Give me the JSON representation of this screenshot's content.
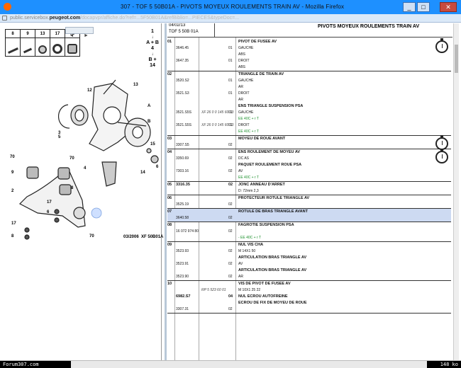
{
  "window": {
    "title": "307 - TOF 5 50B01A - PIVOTS MOYEUX ROULEMENTS TRAIN AV - Mozilla Firefox",
    "minimize_glyph": "_",
    "maximize_glyph": "□",
    "close_glyph": "✕"
  },
  "address_bar": {
    "url_prefix": "public.servicebox.",
    "url_bold": "peugeot.com",
    "url_rest": "/docapvpr/affiche.do?ref=...5F50B01A&refBiblio=...PIECES&typeDoc=..."
  },
  "diagram_panel": {
    "parts_header": [
      "8",
      "9",
      "13",
      "17",
      "70"
    ],
    "nav_arrows": [
      "◄",
      "►"
    ],
    "ref_box_1": {
      "num": "1",
      "arrow": "↓",
      "label": "A + B"
    },
    "ref_box_2": {
      "num": "4",
      "arrow": "↓",
      "label": "B + 14"
    },
    "callouts": [
      "13",
      "12",
      "3",
      "A",
      "5",
      "B",
      "15",
      "4",
      "14",
      "6",
      "70",
      "9",
      "70",
      "8",
      "2",
      "17",
      "7",
      "6",
      "17",
      "8",
      "70"
    ],
    "doc_date": "03/2006",
    "doc_ref": "XF 50B01A"
  },
  "document": {
    "date": "04/02/13",
    "ref": "TOF 5 50B 01A",
    "heading": "PIVOTS MOYEUX ROULEMENTS TRAIN AV",
    "rows": [
      {
        "item": "01",
        "highlight": false,
        "stopwatch": true,
        "lines": [
          {
            "ref": "",
            "num": "",
            "qty": "",
            "desc": "PIVOT DE FUSEE AV",
            "title": true
          },
          {
            "ref": "3646.45",
            "num": "",
            "qty": "01",
            "desc": "GAUCHE"
          },
          {
            "ref": "",
            "num": "",
            "qty": "",
            "desc": "ABS"
          },
          {
            "ref": "3647.35",
            "num": "",
            "qty": "01",
            "desc": "DROIT"
          },
          {
            "ref": "",
            "num": "",
            "qty": "",
            "desc": "ABS"
          }
        ]
      },
      {
        "item": "02",
        "highlight": false,
        "stopwatch": false,
        "lines": [
          {
            "ref": "",
            "num": "",
            "qty": "",
            "desc": "TRIANGLE DE TRAIN AV",
            "title": true
          },
          {
            "ref": "3520.S2",
            "num": "",
            "qty": "01",
            "desc": "GAUCHE"
          },
          {
            "ref": "",
            "num": "",
            "qty": "",
            "desc": "AR"
          },
          {
            "ref": "3521.S3",
            "num": "",
            "qty": "01",
            "desc": "DROIT"
          },
          {
            "ref": "",
            "num": "",
            "qty": "",
            "desc": "AR"
          },
          {
            "ref": "",
            "num": "",
            "qty": "",
            "desc": "ENS TRIANGLE SUSPENSION PSA",
            "title": true
          },
          {
            "ref": "3521.S5S",
            "num": "XF 26 0 0 145 60 03",
            "qty": "01",
            "desc": "GAUCHE"
          },
          {
            "ref": "",
            "num": "",
            "qty": "",
            "desc": "EE 40C + r T",
            "green": true
          },
          {
            "ref": "3521.S5S",
            "num": "XF 26 0 0 145 60 03",
            "qty": "01",
            "desc": "DROIT"
          },
          {
            "ref": "",
            "num": "",
            "qty": "",
            "desc": "EE 40C + r T",
            "green": true
          }
        ]
      },
      {
        "item": "03",
        "highlight": false,
        "stopwatch": true,
        "lines": [
          {
            "ref": "",
            "num": "",
            "qty": "",
            "desc": "MOYEU DE ROUE AVANT",
            "title": true
          },
          {
            "ref": "3307.S5",
            "num": "",
            "qty": "02",
            "desc": ""
          }
        ]
      },
      {
        "item": "04",
        "highlight": false,
        "stopwatch": true,
        "lines": [
          {
            "ref": "",
            "num": "",
            "qty": "",
            "desc": "ENS ROULEMENT DE MOYEU AV",
            "title": true
          },
          {
            "ref": "3350.69",
            "num": "",
            "qty": "02",
            "desc": "DC AS"
          },
          {
            "ref": "",
            "num": "",
            "qty": "",
            "desc": "PAQUET ROULEMENT ROUE PSA",
            "title": true
          },
          {
            "ref": "7303.16",
            "num": "",
            "qty": "02",
            "desc": "AV"
          },
          {
            "ref": "",
            "num": "",
            "qty": "",
            "desc": "EE 40C + r T",
            "green": true
          }
        ]
      },
      {
        "item": "05",
        "highlight": false,
        "stopwatch": false,
        "lines": [
          {
            "ref": "3316.35",
            "num": "",
            "qty": "02",
            "desc": "JONC ANNEAU D'ARRET",
            "title": true
          },
          {
            "ref": "",
            "num": "",
            "qty": "",
            "desc": "D: 72mm 2,3"
          }
        ]
      },
      {
        "item": "06",
        "highlight": false,
        "stopwatch": false,
        "lines": [
          {
            "ref": "",
            "num": "",
            "qty": "",
            "desc": "PROTECTEUR ROTULE TRIANGLE AV",
            "title": true
          },
          {
            "ref": "3525.19",
            "num": "",
            "qty": "02",
            "desc": ""
          }
        ]
      },
      {
        "item": "07",
        "highlight": true,
        "stopwatch": false,
        "lines": [
          {
            "ref": "",
            "num": "",
            "qty": "",
            "desc": "ROTULE DE BRAS TRIANGLE AVANT",
            "title": true
          },
          {
            "ref": "3640.58",
            "num": "",
            "qty": "02",
            "desc": ""
          }
        ]
      },
      {
        "item": "08",
        "highlight": false,
        "stopwatch": false,
        "lines": [
          {
            "ref": "",
            "num": "",
            "qty": "",
            "desc": "FAGROTIE SUSPENSION PSA",
            "title": true
          },
          {
            "ref": "16 072 974 80",
            "num": "",
            "qty": "02",
            "desc": ""
          },
          {
            "ref": "",
            "num": "",
            "qty": "",
            "desc": "- EE 40C + r T",
            "green": true
          }
        ]
      },
      {
        "item": "09",
        "highlight": false,
        "stopwatch": false,
        "lines": [
          {
            "ref": "",
            "num": "",
            "qty": "",
            "desc": "NUL VIS CHA",
            "title": true
          },
          {
            "ref": "3523.93",
            "num": "",
            "qty": "02",
            "desc": "M 14X1 50"
          },
          {
            "ref": "",
            "num": "",
            "qty": "",
            "desc": "ARTICULATION BRAS TRIANGLE AV",
            "title": true
          },
          {
            "ref": "3523.91",
            "num": "",
            "qty": "02",
            "desc": "AV"
          },
          {
            "ref": "",
            "num": "",
            "qty": "",
            "desc": "ARTICULATION BRAS TRIANGLE AV",
            "title": true
          },
          {
            "ref": "3523.90",
            "num": "",
            "qty": "02",
            "desc": "AR"
          }
        ]
      },
      {
        "item": "10",
        "highlight": false,
        "stopwatch": false,
        "lines": [
          {
            "ref": "",
            "num": "",
            "qty": "",
            "desc": "VIS DE PIVOT DE FUSEE AV",
            "title": true
          },
          {
            "ref": "",
            "num": "RP 5 523 60 01",
            "qty": "",
            "desc": "M 10X1 25 22"
          },
          {
            "ref": "6982.S7",
            "num": "",
            "qty": "04",
            "desc": "NUL ECROU AUTOFREINE",
            "title": true
          },
          {
            "ref": "",
            "num": "",
            "qty": "",
            "desc": "ECROU DE FIX DE MOYEU DE ROUE",
            "title": true
          },
          {
            "ref": "3307.31",
            "num": "",
            "qty": "02",
            "desc": ""
          }
        ]
      }
    ]
  },
  "status": {
    "site": "Forum307.com",
    "size": "148 ko"
  },
  "colors": {
    "titlebar": "#1e90ff",
    "highlight_row": "#cddaf2",
    "green_text": "#1a8f2a"
  }
}
